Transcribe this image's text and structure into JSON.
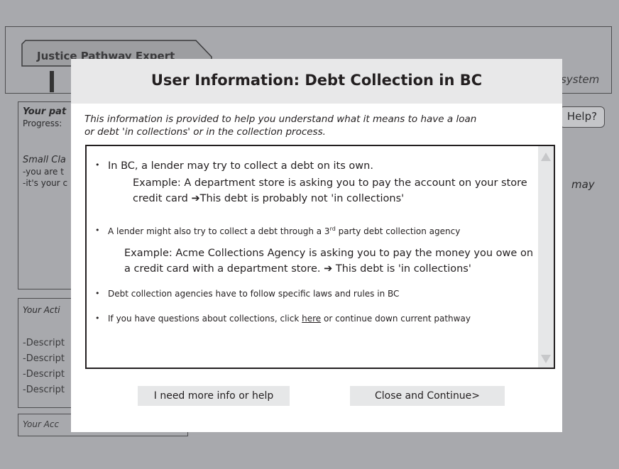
{
  "app": {
    "title": "Justice Pathway Expert",
    "header_right": "system"
  },
  "sidebar": {
    "path_title": "Your pat",
    "progress_label": "Progress:",
    "small_claims": "Small Cla",
    "lines": [
      "-you are t",
      "-it's your c"
    ]
  },
  "help_button": "Help?",
  "right_text": "may",
  "actions": {
    "title": "Your Acti",
    "items": [
      "-Descript",
      "-Descript",
      "-Descript",
      "-Descript"
    ]
  },
  "account": {
    "title": "Your Acc"
  },
  "modal": {
    "title": "User Information: Debt Collection in BC",
    "intro_line1": "This information is provided to help you understand what it means to have a loan",
    "intro_line2": "or debt 'in collections' or in the collection process.",
    "bullet1": "In BC, a lender may try to collect a debt on its own.",
    "example1_line1": "Example: A department store is asking you to pay the account on your store",
    "example1_line2": "credit card ➔This debt is probably not 'in collections'",
    "bullet2_pre": "A lender might also try to collect a debt through a 3",
    "bullet2_sup": "rd",
    "bullet2_post": " party debt collection agency",
    "example2_line1": "Example: Acme Collections Agency is asking you to pay the money you owe on",
    "example2_line2": "a credit card with a department store. ➔ This debt is  'in collections'",
    "bullet3": "Debt collection agencies have to follow specific laws and rules in BC",
    "bullet4_pre": "If you have questions about collections, click ",
    "bullet4_link": "here",
    "bullet4_post": " or continue down current pathway",
    "btn_more_info": "I need more info or help",
    "btn_close": "Close and Continue>"
  }
}
